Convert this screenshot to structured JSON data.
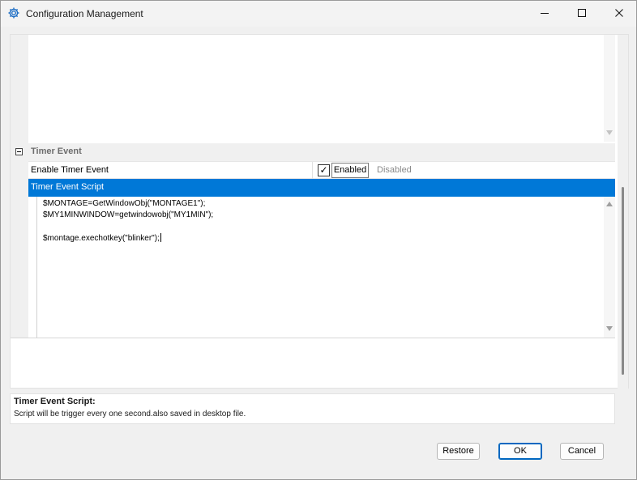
{
  "window": {
    "title": "Configuration Management",
    "icons": {
      "app": "gear-icon",
      "minimize": "minimize-icon",
      "maximize": "maximize-icon",
      "close": "close-icon"
    }
  },
  "grid": {
    "category": {
      "label": "Timer Event",
      "collapse_icon": "collapse-minus-icon"
    },
    "property": {
      "name": "Enable Timer Event",
      "checkbox_mark": "✓",
      "enabled_label": "Enabled",
      "disabled_label": "Disabled",
      "checked": true
    },
    "script_header": "Timer Event Script",
    "script_lines": [
      "$MONTAGE=GetWindowObj(\"MONTAGE1\");",
      "$MY1MINWINDOW=getwindowobj(\"MY1MIN\");",
      "",
      "$montage.exechotkey(\"blinker\");"
    ],
    "colors": {
      "selection": "#0078d7"
    }
  },
  "description": {
    "title": "Timer Event Script:",
    "text": "Script will be trigger every one second.also saved in desktop file."
  },
  "buttons": {
    "restore": "Restore",
    "ok": "OK",
    "cancel": "Cancel"
  }
}
